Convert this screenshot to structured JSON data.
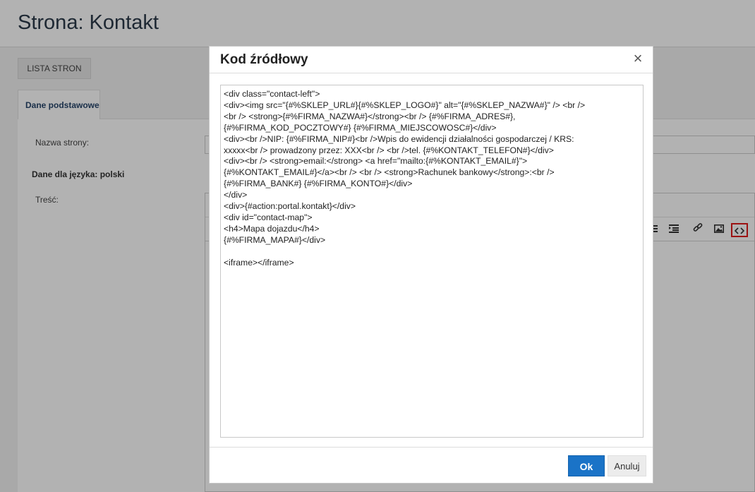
{
  "page": {
    "title": "Strona: Kontakt",
    "list_button": "LISTA STRON",
    "tab_basic": "Dane podstawowe",
    "name_label": "Nazwa strony:",
    "lang_label": "Dane dla języka: polski",
    "content_label": "Treść:"
  },
  "editor_toolbar": {
    "icons": [
      "bullet-list-icon",
      "indent-icon",
      "link-icon",
      "image-icon",
      "source-code-icon"
    ],
    "highlighted": "source-code-icon"
  },
  "modal": {
    "title": "Kod źródłowy",
    "close_glyph": "×",
    "code_value": "<div class=\"contact-left\">\n<div><img src=\"{#%SKLEP_URL#}{#%SKLEP_LOGO#}\" alt=\"{#%SKLEP_NAZWA#}\" /> <br />\n<br /> <strong>{#%FIRMA_NAZWA#}</strong><br /> {#%FIRMA_ADRES#},\n{#%FIRMA_KOD_POCZTOWY#} {#%FIRMA_MIEJSCOWOSC#}</div>\n<div><br />NIP: {#%FIRMA_NIP#}<br />Wpis do ewidencji działalności gospodarczej / KRS:\nxxxxx<br /> prowadzony przez: XXX<br /> <br />tel. {#%KONTAKT_TELEFON#}</div>\n<div><br /> <strong>email:</strong> <a href=\"mailto:{#%KONTAKT_EMAIL#}\">\n{#%KONTAKT_EMAIL#}</a><br /> <br /> <strong>Rachunek bankowy</strong>:<br />\n{#%FIRMA_BANK#} {#%FIRMA_KONTO#}</div>\n</div>\n<div>{#action:portal.kontakt}</div>\n<div id=\"contact-map\">\n<h4>Mapa dojazdu</h4>\n{#%FIRMA_MAPA#}</div>\n\n<iframe></iframe>",
    "ok_label": "Ok",
    "cancel_label": "Anuluj"
  },
  "colors": {
    "primary": "#1a73c7",
    "highlight": "#e01b1b",
    "title": "#2b3a4a"
  }
}
